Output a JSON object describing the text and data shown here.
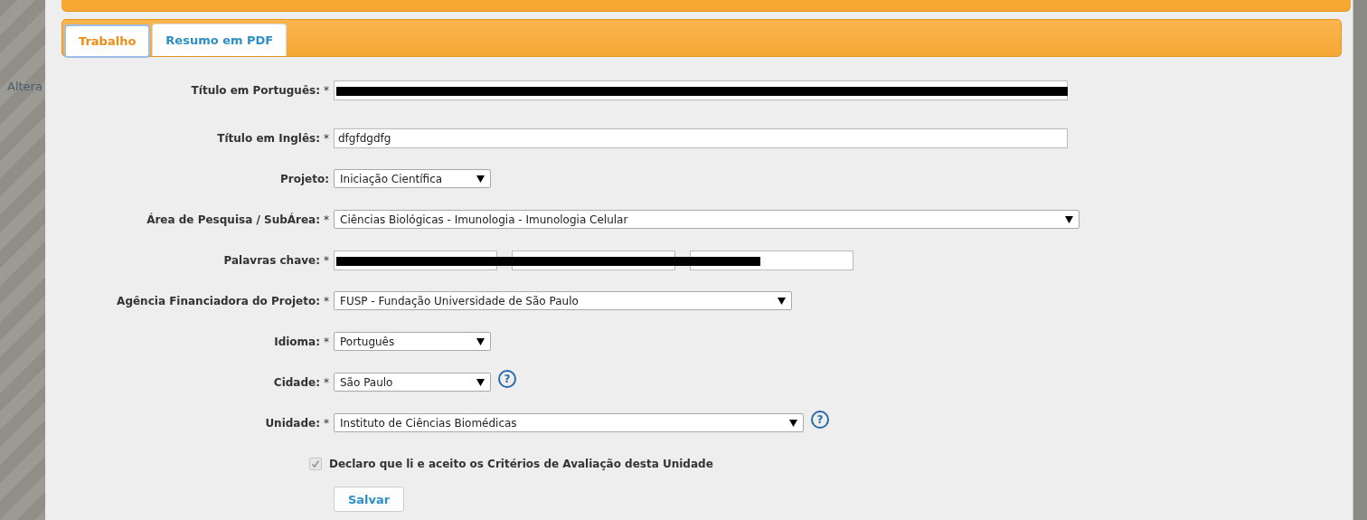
{
  "background_text": "Altera",
  "tabs": [
    {
      "label": "Trabalho",
      "selected": true
    },
    {
      "label": "Resumo em PDF",
      "selected": false
    }
  ],
  "fields": [
    {
      "kind": "text",
      "label": "Título em Português:",
      "required": "*",
      "redacted": true
    },
    {
      "kind": "text",
      "label": "Título em Inglês:",
      "required": "*",
      "value": "dfgfdgdfg"
    },
    {
      "kind": "select",
      "label": "Projeto:",
      "value": "Iniciação Científica"
    },
    {
      "kind": "select",
      "label": "Área de Pesquisa / SubÁrea:",
      "required": "*",
      "value": "Ciências Biológicas - Imunologia - Imunologia Celular"
    },
    {
      "kind": "keywords",
      "label": "Palavras chave:",
      "required": "*",
      "inputs": [
        {
          "redacted": true
        },
        {
          "redacted": true
        },
        {
          "redacted": true
        }
      ]
    },
    {
      "kind": "select",
      "label": "Agência Financiadora do Projeto:",
      "required": "*",
      "value": "FUSP - Fundação Universidade de São Paulo"
    },
    {
      "kind": "select",
      "label": "Idioma:",
      "required": "*",
      "value": "Português"
    },
    {
      "kind": "select",
      "label": "Cidade:",
      "required": "*",
      "value": "São Paulo",
      "help": "?"
    },
    {
      "kind": "select",
      "label": "Unidade:",
      "required": "*",
      "value": "Instituto de Ciências Biomédicas",
      "help": "?"
    }
  ],
  "agreement": {
    "label": "Declaro que li e aceito os Critérios de Avaliação desta Unidade",
    "checked": true,
    "disabled": true
  },
  "save_button": "Salvar"
}
